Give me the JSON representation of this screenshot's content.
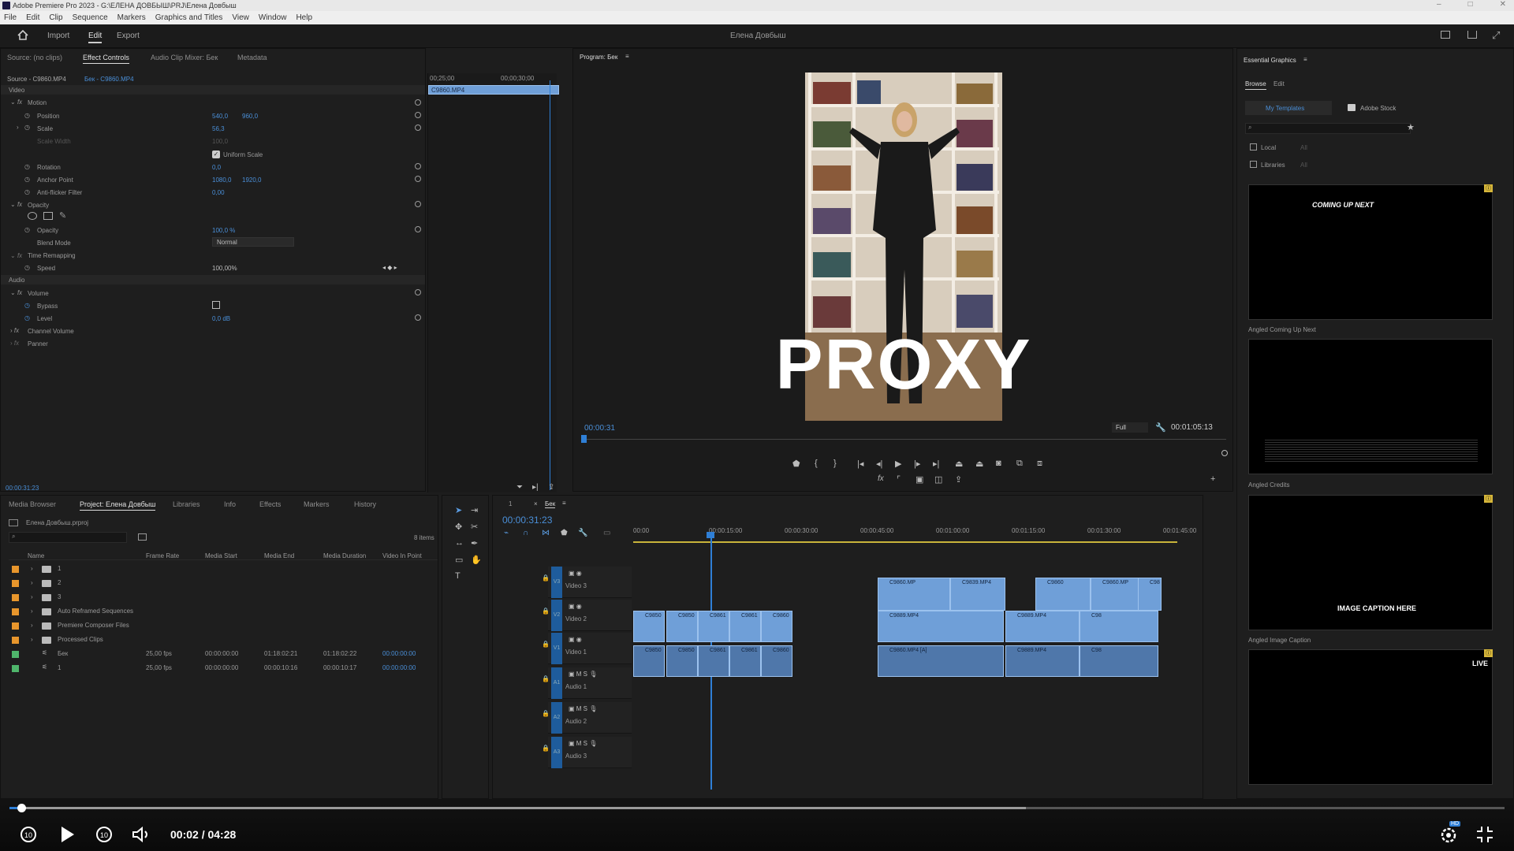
{
  "window": {
    "title": "Adobe Premiere Pro 2023 - G:\\ЕЛЕНА ДОВБЫШ\\PRJ\\Елена Довбыш"
  },
  "menu": [
    "File",
    "Edit",
    "Clip",
    "Sequence",
    "Markers",
    "Graphics and Titles",
    "View",
    "Window",
    "Help"
  ],
  "workspace": {
    "tabs": [
      "Import",
      "Edit",
      "Export"
    ],
    "active": "Edit",
    "project_title": "Елена Довбыш"
  },
  "source_panel": {
    "tabs": [
      "Source: (no clips)",
      "Effect Controls",
      "Audio Clip Mixer: Бек",
      "Metadata"
    ],
    "active": "Effect Controls",
    "source_label": "Source - C9860.MP4",
    "seq_label": "Бек - C9860.MP4",
    "time1": "00;25;00",
    "time2": "00;00;30;00",
    "clip_name": "C9860.MP4",
    "current_time": "00:00:31:23"
  },
  "effects": {
    "video_header": "Video",
    "motion": "Motion",
    "position_label": "Position",
    "position_x": "540,0",
    "position_y": "960,0",
    "scale_label": "Scale",
    "scale_val": "56,3",
    "scale_width_label": "Scale Width",
    "scale_width_val": "100,0",
    "uniform_scale": "Uniform Scale",
    "rotation_label": "Rotation",
    "rotation_val": "0,0",
    "anchor_label": "Anchor Point",
    "anchor_x": "1080,0",
    "anchor_y": "1920,0",
    "antiflicker_label": "Anti-flicker Filter",
    "antiflicker_val": "0,00",
    "opacity_header": "Opacity",
    "opacity_label": "Opacity",
    "opacity_val": "100,0 %",
    "blend_label": "Blend Mode",
    "blend_val": "Normal",
    "time_remap": "Time Remapping",
    "speed_label": "Speed",
    "speed_val": "100,00%",
    "audio_header": "Audio",
    "volume": "Volume",
    "bypass_label": "Bypass",
    "level_label": "Level",
    "level_val": "0,0 dB",
    "channel_volume": "Channel Volume",
    "panner": "Panner"
  },
  "program": {
    "title": "Program: Бек",
    "timecode_left": "00:00:31",
    "timecode_right": "00:01:05:13",
    "zoom": "Full",
    "overlay_text": "PROXY"
  },
  "essential_graphics": {
    "title": "Essential Graphics",
    "tabs": [
      "Browse",
      "Edit"
    ],
    "my_templates": "My Templates",
    "adobe_stock": "Adobe Stock",
    "local": "Local",
    "libraries": "Libraries",
    "dropdown_val": "All",
    "templates": [
      {
        "name": "Angled Coming Up Next",
        "text": "COMING UP NEXT"
      },
      {
        "name": "Angled Credits",
        "text": ""
      },
      {
        "name": "Angled Image Caption",
        "text": "IMAGE CAPTION HERE"
      },
      {
        "name": "",
        "text": "LIVE"
      }
    ]
  },
  "project": {
    "tabs": [
      "Media Browser",
      "Project: Елена Довбыш",
      "Libraries",
      "Info",
      "Effects",
      "Markers",
      "History"
    ],
    "active": "Project: Елена Довбыш",
    "file": "Елена Довбыш.prproj",
    "item_count": "8 items",
    "columns": [
      "Name",
      "Frame Rate",
      "Media Start",
      "Media End",
      "Media Duration",
      "Video In Point"
    ],
    "rows": [
      {
        "name": "1",
        "color": "#e8962c",
        "type": "folder",
        "fr": "",
        "ms": "",
        "me": "",
        "md": "",
        "vi": ""
      },
      {
        "name": "2",
        "color": "#e8962c",
        "type": "folder",
        "fr": "",
        "ms": "",
        "me": "",
        "md": "",
        "vi": ""
      },
      {
        "name": "3",
        "color": "#e8962c",
        "type": "folder",
        "fr": "",
        "ms": "",
        "me": "",
        "md": "",
        "vi": ""
      },
      {
        "name": "Auto Reframed Sequences",
        "color": "#e8962c",
        "type": "folder",
        "fr": "",
        "ms": "",
        "me": "",
        "md": "",
        "vi": ""
      },
      {
        "name": "Premiere Composer Files",
        "color": "#e8962c",
        "type": "folder",
        "fr": "",
        "ms": "",
        "me": "",
        "md": "",
        "vi": ""
      },
      {
        "name": "Processed Clips",
        "color": "#e8962c",
        "type": "folder",
        "fr": "",
        "ms": "",
        "me": "",
        "md": "",
        "vi": ""
      },
      {
        "name": "Бек",
        "color": "#4fb66b",
        "type": "seq",
        "fr": "25,00 fps",
        "ms": "00:00:00:00",
        "me": "01:18:02:21",
        "md": "01:18:02:22",
        "vi": "00:00:00:00"
      },
      {
        "name": "1",
        "color": "#4fb66b",
        "type": "seq",
        "fr": "25,00 fps",
        "ms": "00:00:00:00",
        "me": "00:00:10:16",
        "md": "00:00:10:17",
        "vi": "00:00:00:00"
      }
    ]
  },
  "timeline": {
    "tab_num": "1",
    "seq_name": "Бек",
    "timecode": "00:00:31:23",
    "ruler": [
      "00:00",
      "00:00:15:00",
      "00:00:30:00",
      "00:00:45:00",
      "00:01:00:00",
      "00:01:15:00",
      "00:01:30:00",
      "00:01:45:00"
    ],
    "tracks": [
      {
        "id": "V3",
        "name": "Video 3"
      },
      {
        "id": "V2",
        "name": "Video 2"
      },
      {
        "id": "V1",
        "name": "Video 1"
      },
      {
        "id": "A1",
        "name": "Audio 1"
      },
      {
        "id": "A2",
        "name": "Audio 2"
      },
      {
        "id": "A3",
        "name": "Audio 3"
      }
    ],
    "clip_labels": [
      "C9860.MP",
      "C9839.MP4",
      "C9850",
      "C9861",
      "C9860",
      "C9860.MP4 [A]",
      "C9889.MP4",
      "C98"
    ]
  },
  "player": {
    "time": "00:02 / 04:28",
    "progress": 0.008,
    "buffered": 0.68,
    "badge": "HD"
  },
  "colors": {
    "accent": "#2f7fd6",
    "clip_video": "#6f9fd8",
    "clip_audio": "#4f77aa",
    "folder": "#e8962c",
    "sequence": "#4fb66b"
  }
}
